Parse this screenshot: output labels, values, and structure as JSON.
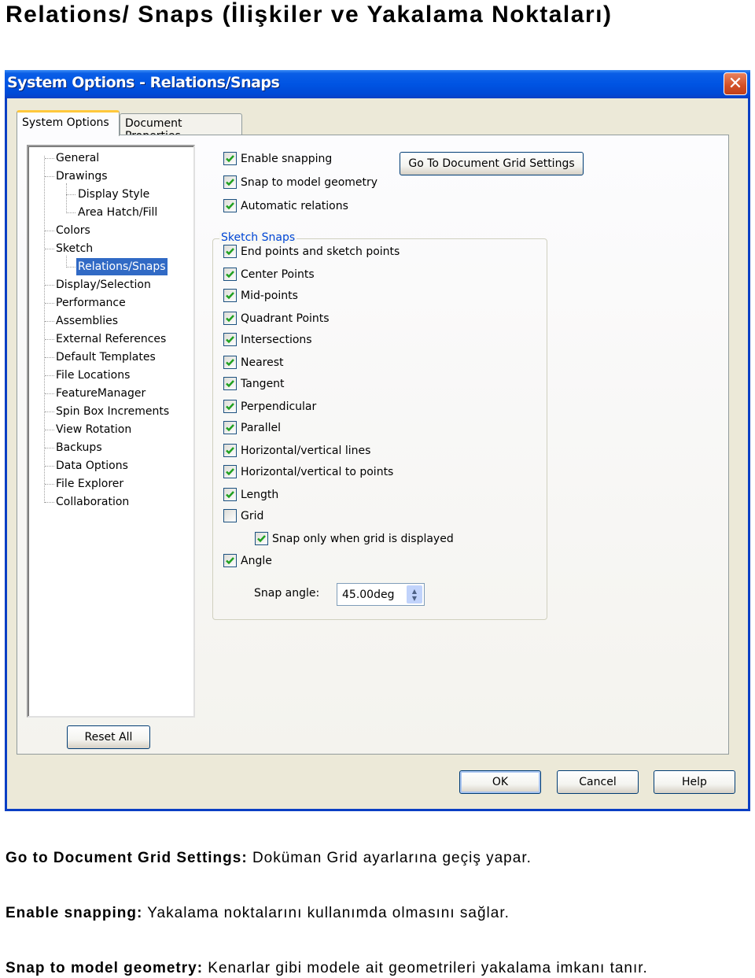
{
  "page": {
    "title": "Relations/ Snaps (İlişkiler ve Yakalama Noktaları)"
  },
  "window": {
    "title": "System Options - Relations/Snaps",
    "close_icon": "close-x-icon",
    "tabs": [
      {
        "label": "System Options",
        "active": true
      },
      {
        "label": "Document Properties",
        "active": false
      }
    ],
    "tree": [
      {
        "label": "General",
        "level": 0
      },
      {
        "label": "Drawings",
        "level": 0
      },
      {
        "label": "Display Style",
        "level": 1
      },
      {
        "label": "Area Hatch/Fill",
        "level": 1
      },
      {
        "label": "Colors",
        "level": 0
      },
      {
        "label": "Sketch",
        "level": 0
      },
      {
        "label": "Relations/Snaps",
        "level": 1,
        "selected": true
      },
      {
        "label": "Display/Selection",
        "level": 0
      },
      {
        "label": "Performance",
        "level": 0
      },
      {
        "label": "Assemblies",
        "level": 0
      },
      {
        "label": "External References",
        "level": 0
      },
      {
        "label": "Default Templates",
        "level": 0
      },
      {
        "label": "File Locations",
        "level": 0
      },
      {
        "label": "FeatureManager",
        "level": 0
      },
      {
        "label": "Spin Box Increments",
        "level": 0
      },
      {
        "label": "View Rotation",
        "level": 0
      },
      {
        "label": "Backups",
        "level": 0
      },
      {
        "label": "Data Options",
        "level": 0
      },
      {
        "label": "File Explorer",
        "level": 0
      },
      {
        "label": "Collaboration",
        "level": 0
      }
    ],
    "reset_all_label": "Reset All",
    "go_to_grid_label": "Go To Document Grid Settings",
    "top_options": [
      {
        "label": "Enable snapping",
        "checked": true
      },
      {
        "label": "Snap to model geometry",
        "checked": true
      },
      {
        "label": "Automatic relations",
        "checked": true
      }
    ],
    "sketch_snaps": {
      "label": "Sketch Snaps",
      "options": [
        {
          "label": "End points and sketch points",
          "checked": true
        },
        {
          "label": "Center Points",
          "checked": true
        },
        {
          "label": "Mid-points",
          "checked": true
        },
        {
          "label": "Quadrant Points",
          "checked": true
        },
        {
          "label": "Intersections",
          "checked": true
        },
        {
          "label": "Nearest",
          "checked": true
        },
        {
          "label": "Tangent",
          "checked": true
        },
        {
          "label": "Perpendicular",
          "checked": true
        },
        {
          "label": "Parallel",
          "checked": true
        },
        {
          "label": "Horizontal/vertical lines",
          "checked": true
        },
        {
          "label": "Horizontal/vertical to points",
          "checked": true
        },
        {
          "label": "Length",
          "checked": true
        },
        {
          "label": "Grid",
          "checked": false
        },
        {
          "label": "Snap only when grid is displayed",
          "checked": true,
          "indent": true
        },
        {
          "label": "Angle",
          "checked": true
        }
      ],
      "snap_angle_label": "Snap angle:",
      "snap_angle_value": "45.00deg"
    },
    "buttons": {
      "ok": "OK",
      "cancel": "Cancel",
      "help": "Help"
    }
  },
  "descriptions": [
    {
      "term": "Go to Document Grid Settings:",
      "text": " Doküman Grid ayarlarına geçiş yapar."
    },
    {
      "term": "Enable snapping:",
      "text": " Yakalama noktalarını kullanımda olmasını sağlar."
    },
    {
      "term": "Snap to model geometry:",
      "text": " Kenarlar gibi modele ait geometrileri yakalama imkanı tanır."
    }
  ],
  "colors": {
    "titlebar": "#0054e3",
    "selection": "#316ac5",
    "groupbox_label": "#0046d5",
    "checkmark": "#21a121",
    "close_button": "#d24f25"
  }
}
